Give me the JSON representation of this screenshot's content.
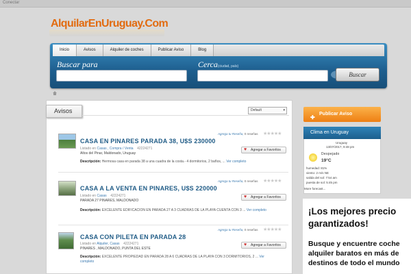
{
  "topbar": {
    "connect_label": "Conectar"
  },
  "logo": {
    "text": "AlquilarEnUruguay.Com"
  },
  "nav": {
    "items": [
      {
        "label": "Inicio",
        "active": true
      },
      {
        "label": "Avisos",
        "active": false
      },
      {
        "label": "Alquiler de coches",
        "active": false
      },
      {
        "label": "Publicar Aviso",
        "active": false
      },
      {
        "label": "Blog",
        "active": false
      }
    ]
  },
  "search": {
    "query_label": "Buscar para",
    "near_label": "Cerca",
    "near_hint": "(ciudad, país)",
    "query_value": "",
    "near_value": "",
    "button_label": "Buscar"
  },
  "icons": {
    "home": "home-icon",
    "heart": "heart-icon",
    "star": "star-icon",
    "sun": "sun-icon",
    "publish": "publish-icon"
  },
  "colors": {
    "brand_orange": "#e26b10",
    "nav_blue": "#1e5f8f",
    "link_blue": "#1f5b86",
    "cta_orange": "#ee7f13"
  },
  "main": {
    "section_title": "Avisos",
    "sort_value": "Default",
    "listings": [
      {
        "title": "CASA EN PINARES PARADA 38, U$S 230000",
        "listed_prefix": "Listado en",
        "categories": "Casas , Compra / Venta",
        "id": "42224271",
        "location": "Altos del Pinar, Maldonado, Uruguay",
        "desc_label": "Descripción:",
        "desc": "Hermosa casa en parada 38 a una cuadra de la costa.- 4 dormitorios, 2 baños, ...",
        "more": "Ver completo",
        "review_link": "Agrega tu Reseña,",
        "review_count": "0 reseñas",
        "rating": 0,
        "fav_label": "Agregar a Favoritos"
      },
      {
        "title": "CASA A LA VENTA EN PINARES, U$S 220000",
        "listed_prefix": "Listado en",
        "categories": "Casas",
        "id": "42224271",
        "location": "PARADA 27 PINARES, MALDONADO",
        "desc_label": "Descripción:",
        "desc": "EXCELENTE EDIFICACION EN PARADA 27 A 3 CUADRAS DE LA PLAYA CUENTA CON 3 ...",
        "more": "Ver completo",
        "review_link": "Agrega tu Reseña,",
        "review_count": "0 reseñas",
        "rating": 0,
        "fav_label": "Agregar a Favoritos"
      },
      {
        "title": "CASA CON PILETA EN PARADA 28",
        "listed_prefix": "Listado en",
        "categories": "Alquiler, Casas",
        "id": "42224271",
        "location": "PINARES , MALDONADO, PUNTA DEL ESTE",
        "desc_label": "Descripción:",
        "desc": "EXCELENTE PROPIEDAD EN PARADA 28 A 6 CUADRAS DE LA PLAYA CON 3 DORMITORIOS, 2 ...",
        "more": "Ver completo",
        "review_link": "Agrega tu Reseña,",
        "review_count": "0 reseñas",
        "rating": 0,
        "fav_label": "Agregar a Favoritos"
      }
    ]
  },
  "sidebar": {
    "publish_label": "Publicar Aviso",
    "weather": {
      "title": "Clima en Uruguay",
      "city": "Uruguay",
      "date": "13/07/2017, 9:48 pm",
      "condition": "Despejado",
      "temp": "19°C",
      "humidity": "humedad: 81%",
      "wind": "viento: 2 m/s NE",
      "sunrise": "salida del sol: 7:54 am",
      "sunset": "puesta de sol: 5:45 pm",
      "more": "More forecast..."
    },
    "promo": {
      "heading_line1": "¡Los mejores precio",
      "heading_line2": "garantizados!",
      "text_line1": "Busque y encuentre coche",
      "text_line2": "alquiler baratos en más de",
      "text_line3": "destinos de todo el mundo"
    }
  }
}
